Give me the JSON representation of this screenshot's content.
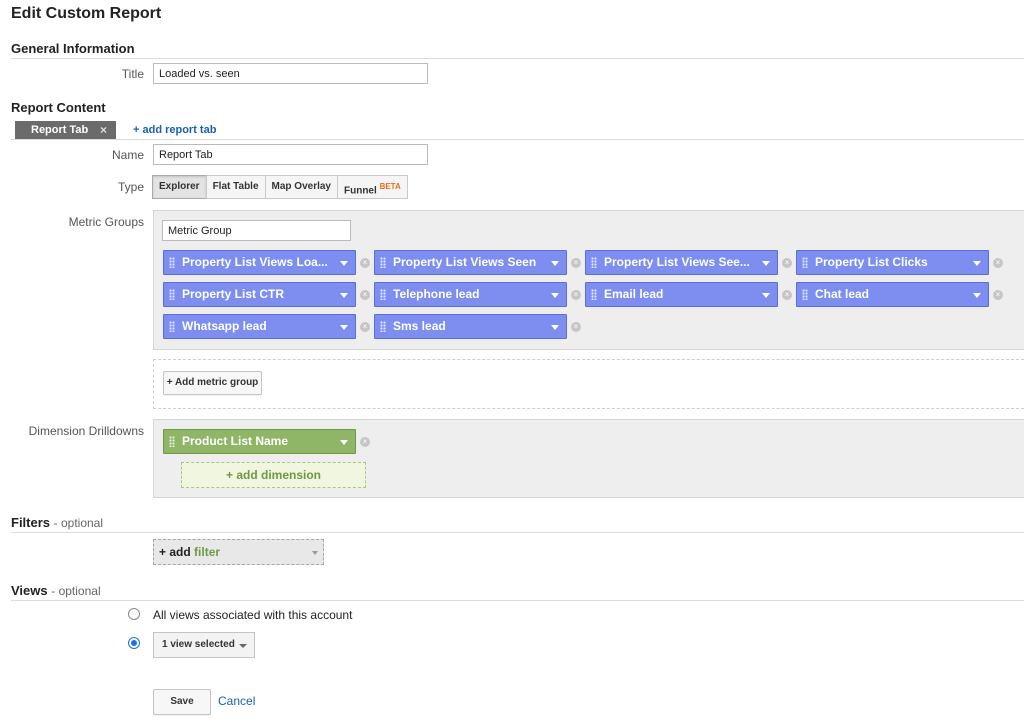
{
  "page": {
    "title": "Edit Custom Report"
  },
  "general": {
    "heading": "General Information",
    "title_label": "Title",
    "title_value": "Loaded vs. seen"
  },
  "content": {
    "heading": "Report Content",
    "tabs": [
      {
        "label": "Report Tab",
        "close": "×"
      }
    ],
    "add_tab": "+ add report tab",
    "name_label": "Name",
    "name_value": "Report Tab",
    "type_label": "Type",
    "types": [
      {
        "label": "Explorer",
        "active": true
      },
      {
        "label": "Flat Table",
        "active": false
      },
      {
        "label": "Map Overlay",
        "active": false
      },
      {
        "label": "Funnel",
        "badge": "BETA",
        "active": false
      }
    ],
    "metric_groups_label": "Metric Groups",
    "metric_group_name": "Metric Group",
    "metrics": [
      "Property List Views Loaded",
      "Property List Views Seen",
      "Property List Views Seen Ratio",
      "Property List Clicks",
      "Property List CTR",
      "Telephone lead",
      "Email lead",
      "Chat lead",
      "Whatsapp lead",
      "Sms lead"
    ],
    "metrics_display": [
      "Property List Views Loa...",
      "Property List Views Seen",
      "Property List Views See...",
      "Property List Clicks",
      "Property List CTR",
      "Telephone lead",
      "Email lead",
      "Chat lead",
      "Whatsapp lead",
      "Sms lead"
    ],
    "add_metric_group": "+ Add metric group",
    "dimension_label": "Dimension Drilldowns",
    "dimensions": [
      "Product List Name"
    ],
    "add_dimension": "+ add dimension"
  },
  "filters": {
    "heading": "Filters",
    "optional": "- optional",
    "add_plus": "+ add",
    "add_word": "filter"
  },
  "views": {
    "heading": "Views",
    "optional": "- optional",
    "option_all": "All views associated with this account",
    "option_selected": "1 view selected",
    "selected_index": 1
  },
  "actions": {
    "save": "Save",
    "cancel": "Cancel"
  },
  "colors": {
    "metric_chip": "#7d8ef0",
    "dimension_chip": "#8fb567",
    "link": "#1a5fb4",
    "beta_badge": "#e86b1c"
  }
}
